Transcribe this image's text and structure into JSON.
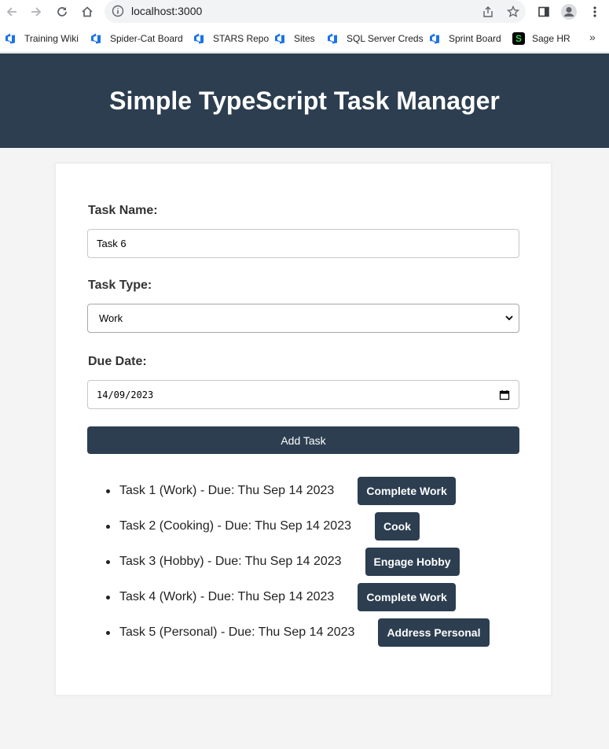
{
  "browser": {
    "url": "localhost:3000",
    "bookmarks": [
      {
        "label": "Training Wiki",
        "icon": "azure-devops-icon"
      },
      {
        "label": "Spider-Cat Board",
        "icon": "azure-devops-icon"
      },
      {
        "label": "STARS Repo",
        "icon": "azure-devops-icon"
      },
      {
        "label": "Sites",
        "icon": "azure-devops-icon"
      },
      {
        "label": "SQL Server Creds",
        "icon": "azure-devops-icon"
      },
      {
        "label": "Sprint Board",
        "icon": "azure-devops-icon"
      },
      {
        "label": "Sage HR",
        "icon": "sage-icon"
      }
    ],
    "more_label": "»",
    "sage_glyph": "S"
  },
  "app": {
    "title": "Simple TypeScript Task Manager",
    "header_color": "#2c3e50"
  },
  "form": {
    "task_name_label": "Task Name:",
    "task_name_value": "Task 6",
    "task_type_label": "Task Type:",
    "task_type_value": "Work",
    "due_date_label": "Due Date:",
    "due_date_value": "14/09/2023",
    "add_button_label": "Add Task"
  },
  "tasks": [
    {
      "text": "Task 1 (Work) - Due: Thu Sep 14 2023",
      "action": "Complete Work"
    },
    {
      "text": "Task 2 (Cooking) - Due: Thu Sep 14 2023",
      "action": "Cook"
    },
    {
      "text": "Task 3 (Hobby) - Due: Thu Sep 14 2023",
      "action": "Engage Hobby"
    },
    {
      "text": "Task 4 (Work) - Due: Thu Sep 14 2023",
      "action": "Complete Work"
    },
    {
      "text": "Task 5 (Personal) - Due: Thu Sep 14 2023",
      "action": "Address Personal"
    }
  ]
}
